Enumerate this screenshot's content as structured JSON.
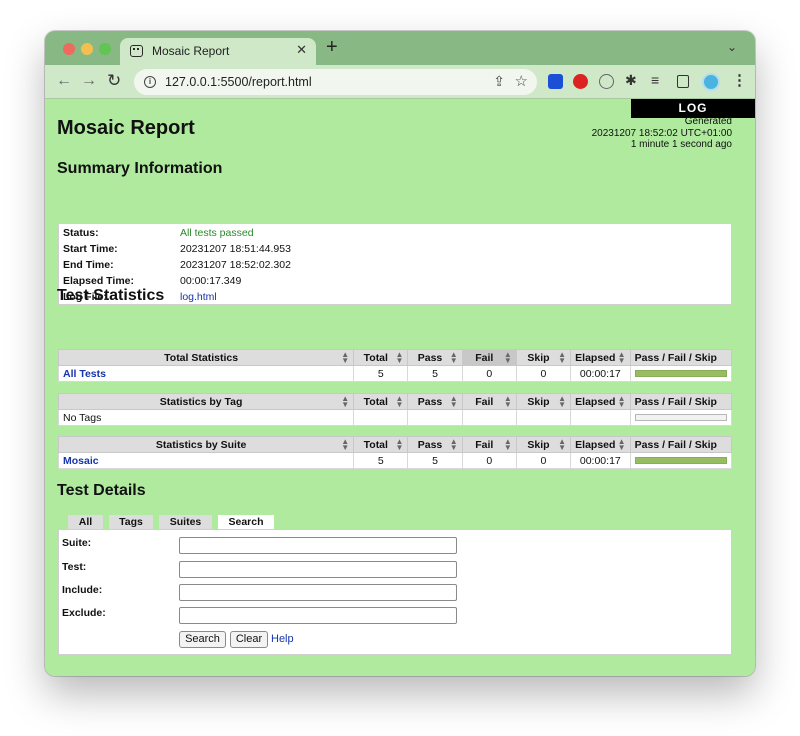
{
  "browser": {
    "tab_title": "Mosaic Report",
    "tab_close": "✕",
    "new_tab": "+",
    "tab_menu": "⌄",
    "url": "127.0.0.1:5500/report.html",
    "nav": {
      "back": "←",
      "forward": "→",
      "reload": "↻"
    }
  },
  "page": {
    "log_label": "LOG",
    "title": "Mosaic Report",
    "generated": {
      "label": "Generated",
      "timestamp": "20231207 18:52:02 UTC+01:00",
      "ago": "1 minute 1 second ago"
    },
    "summary": {
      "heading": "Summary Information",
      "rows": [
        {
          "label": "Status:",
          "value": "All tests passed"
        },
        {
          "label": "Start Time:",
          "value": "20231207 18:51:44.953"
        },
        {
          "label": "End Time:",
          "value": "20231207 18:52:02.302"
        },
        {
          "label": "Elapsed Time:",
          "value": "00:00:17.349"
        },
        {
          "label": "Log File:",
          "value": "log.html"
        }
      ]
    },
    "statistics": {
      "heading": "Test Statistics",
      "columns": [
        "Total",
        "Pass",
        "Fail",
        "Skip",
        "Elapsed",
        "Pass / Fail / Skip"
      ],
      "total": {
        "header": "Total Statistics",
        "row": {
          "name": "All Tests",
          "total": "5",
          "pass": "5",
          "fail": "0",
          "skip": "0",
          "elapsed": "00:00:17",
          "pass_fraction": 1.0
        }
      },
      "tag": {
        "header": "Statistics by Tag",
        "row": {
          "name": "No Tags",
          "total": "",
          "pass": "",
          "fail": "",
          "skip": "",
          "elapsed": "",
          "pass_fraction": 0
        }
      },
      "suite": {
        "header": "Statistics by Suite",
        "row": {
          "name": "Mosaic",
          "total": "5",
          "pass": "5",
          "fail": "0",
          "skip": "0",
          "elapsed": "00:00:17",
          "pass_fraction": 1.0
        }
      }
    },
    "details": {
      "heading": "Test Details",
      "tabs": [
        "All",
        "Tags",
        "Suites",
        "Search"
      ],
      "active_tab": "Search",
      "fields": [
        {
          "label": "Suite:",
          "value": ""
        },
        {
          "label": "Test:",
          "value": ""
        },
        {
          "label": "Include:",
          "value": ""
        },
        {
          "label": "Exclude:",
          "value": ""
        }
      ],
      "search_button": "Search",
      "clear_button": "Clear",
      "help_link": "Help"
    }
  },
  "colors": {
    "page_background": "#afea9f",
    "pass_bar": "#97bd61",
    "link": "#1535a8",
    "pass_text": "#2a8a2a"
  }
}
